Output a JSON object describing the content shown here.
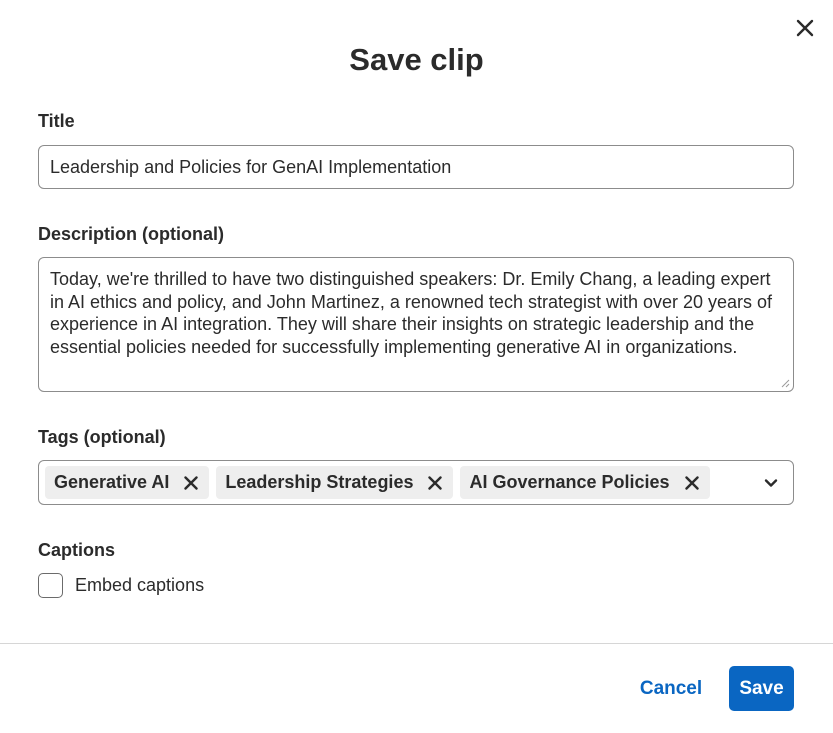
{
  "dialog": {
    "title": "Save clip",
    "close_icon": "close-icon"
  },
  "form": {
    "title_label": "Title",
    "title_value": "Leadership and Policies for GenAI Implementation",
    "description_label": "Description (optional)",
    "description_value": "Today, we're thrilled to have two distinguished speakers: Dr. Emily Chang, a leading expert in AI ethics and policy, and John Martinez, a renowned tech strategist with over 20 years of experience in AI integration. They will share their insights on strategic leadership and the essential policies needed for successfully implementing generative AI in organizations.",
    "tags_label": "Tags (optional)",
    "tags": [
      {
        "label": "Generative AI"
      },
      {
        "label": "Leadership Strategies"
      },
      {
        "label": "AI Governance Policies"
      }
    ],
    "captions_label": "Captions",
    "embed_captions_label": "Embed captions",
    "embed_captions_checked": false
  },
  "footer": {
    "cancel_label": "Cancel",
    "save_label": "Save"
  },
  "colors": {
    "accent": "#0a66c2",
    "text": "#2b2b2b",
    "chip_bg": "#eeeeee",
    "border": "#8c8c8c"
  }
}
